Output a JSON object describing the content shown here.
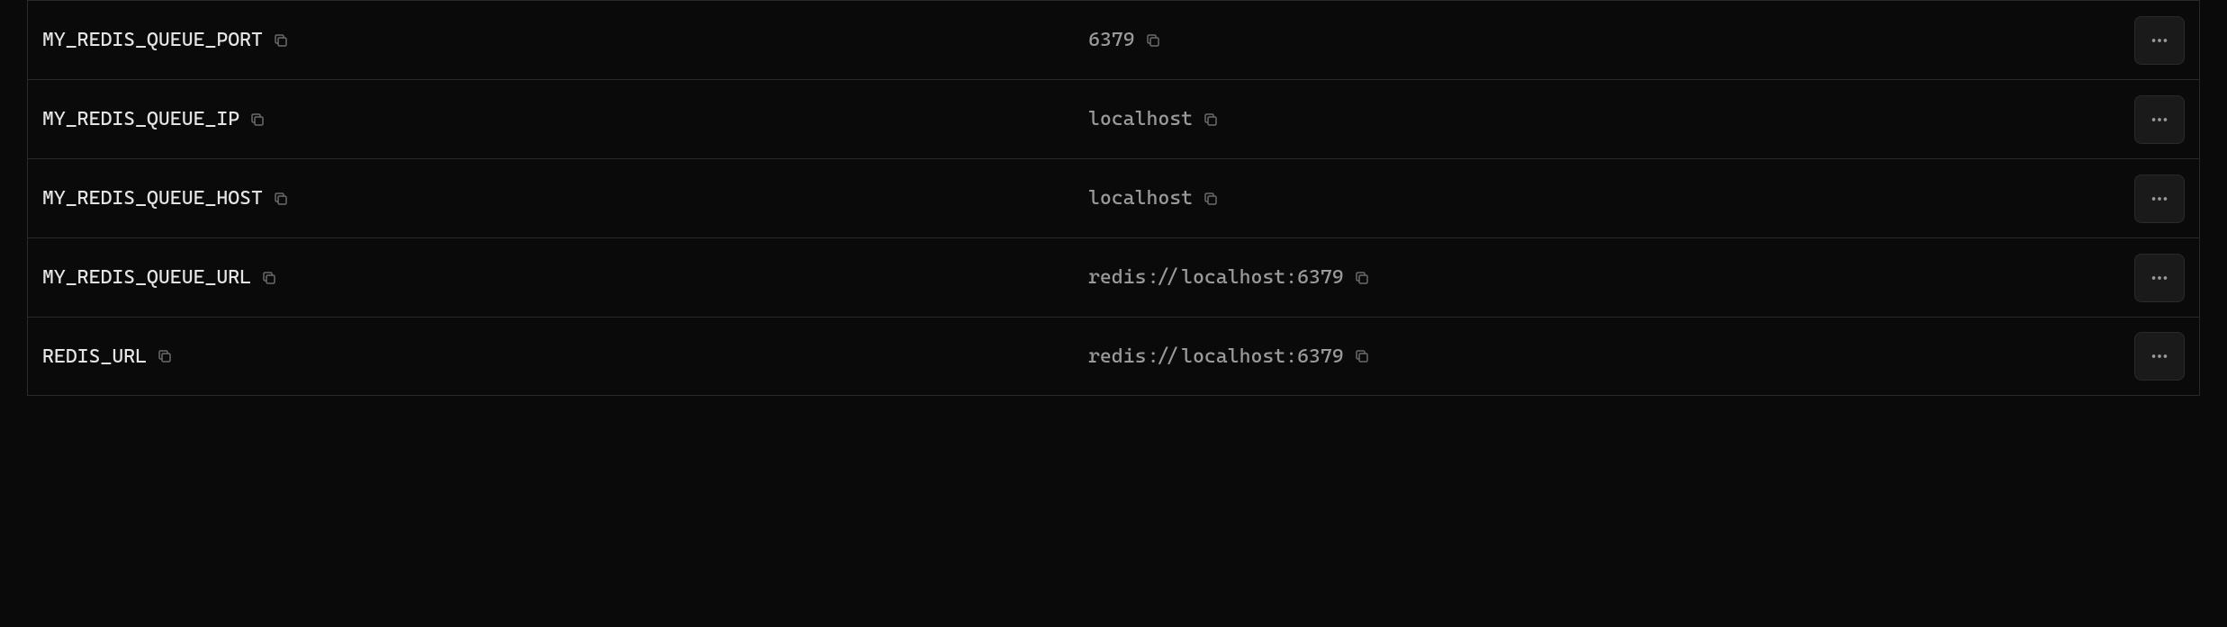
{
  "env_vars": [
    {
      "key": "MY_REDIS_QUEUE_PORT",
      "value": "6379"
    },
    {
      "key": "MY_REDIS_QUEUE_IP",
      "value": "localhost"
    },
    {
      "key": "MY_REDIS_QUEUE_HOST",
      "value": "localhost"
    },
    {
      "key": "MY_REDIS_QUEUE_URL",
      "value": "redis://localhost:6379"
    },
    {
      "key": "REDIS_URL",
      "value": "redis://localhost:6379"
    }
  ]
}
